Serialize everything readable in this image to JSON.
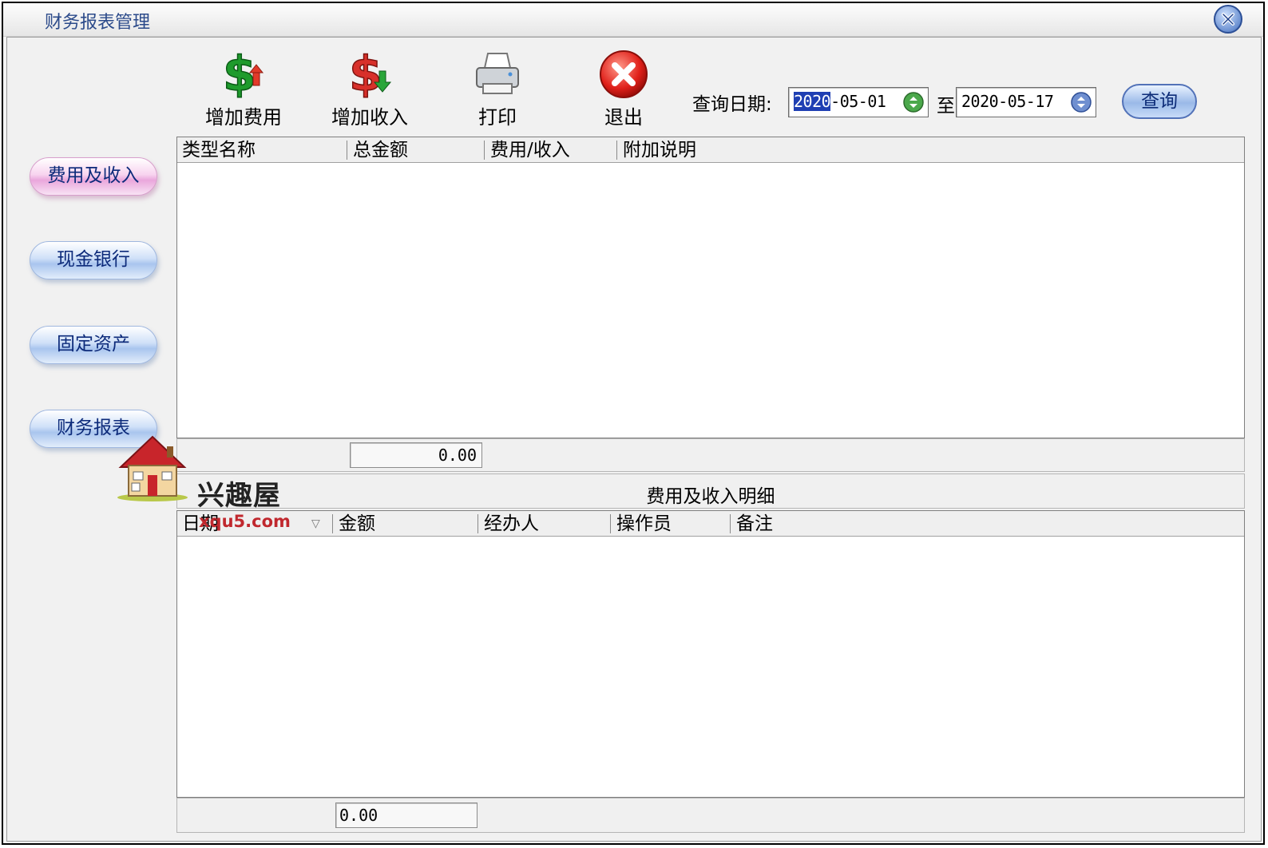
{
  "window": {
    "title": "财务报表管理"
  },
  "toolbar": {
    "add_expense": "增加费用",
    "add_income": "增加收入",
    "print": "打印",
    "exit": "退出"
  },
  "query": {
    "label": "查询日期:",
    "from_year_selected": "2020",
    "from_rest": "-05-01",
    "to_label": "至",
    "to_date": "2020-05-17",
    "button": "查询"
  },
  "sidebar": {
    "items": [
      {
        "label": "费用及收入",
        "active": true
      },
      {
        "label": "现金银行",
        "active": false
      },
      {
        "label": "固定资产",
        "active": false
      },
      {
        "label": "财务报表",
        "active": false
      }
    ]
  },
  "summary_grid": {
    "columns": [
      "类型名称",
      "总金额",
      "费用/收入",
      "附加说明"
    ],
    "rows": [],
    "total": "0.00"
  },
  "detail": {
    "title": "费用及收入明细",
    "columns": [
      "日期",
      "金额",
      "经办人",
      "操作员",
      "备注"
    ],
    "sort_indicator": "▽",
    "rows": [],
    "total": "0.00"
  },
  "watermark": {
    "text": "兴趣屋",
    "url": "xqu5.com"
  },
  "colors": {
    "accent_blue": "#1f3fb3",
    "title_blue": "#2b4a8a",
    "watermark_red": "#c0282e"
  }
}
